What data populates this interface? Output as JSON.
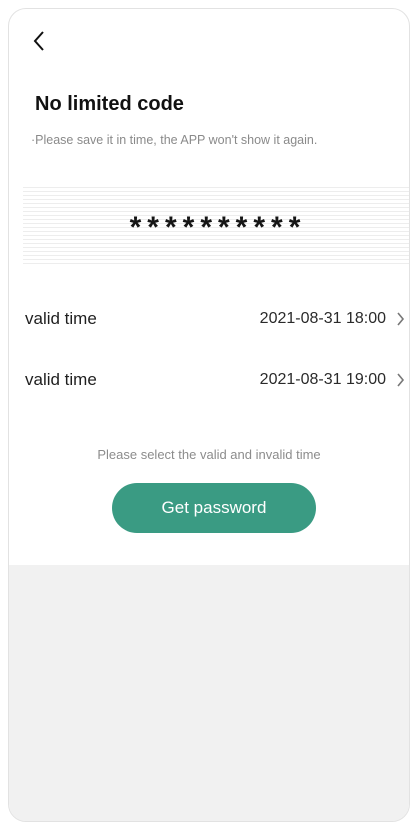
{
  "header": {
    "back_icon": "chevron-left-icon",
    "title": "No limited code",
    "subtitle": "·Please save it in time, the APP won't show it again."
  },
  "code": {
    "masked": "**********"
  },
  "rows": [
    {
      "label": "valid time",
      "value": "2021-08-31 18:00",
      "icon": "chevron-right-icon"
    },
    {
      "label": "valid time",
      "value": "2021-08-31 19:00",
      "icon": "chevron-right-icon"
    }
  ],
  "hint": "Please select the valid and invalid time",
  "actions": {
    "get_password_label": "Get password"
  },
  "colors": {
    "accent": "#3a9b83",
    "background": "#ffffff",
    "footer_background": "#f1f1f1"
  }
}
